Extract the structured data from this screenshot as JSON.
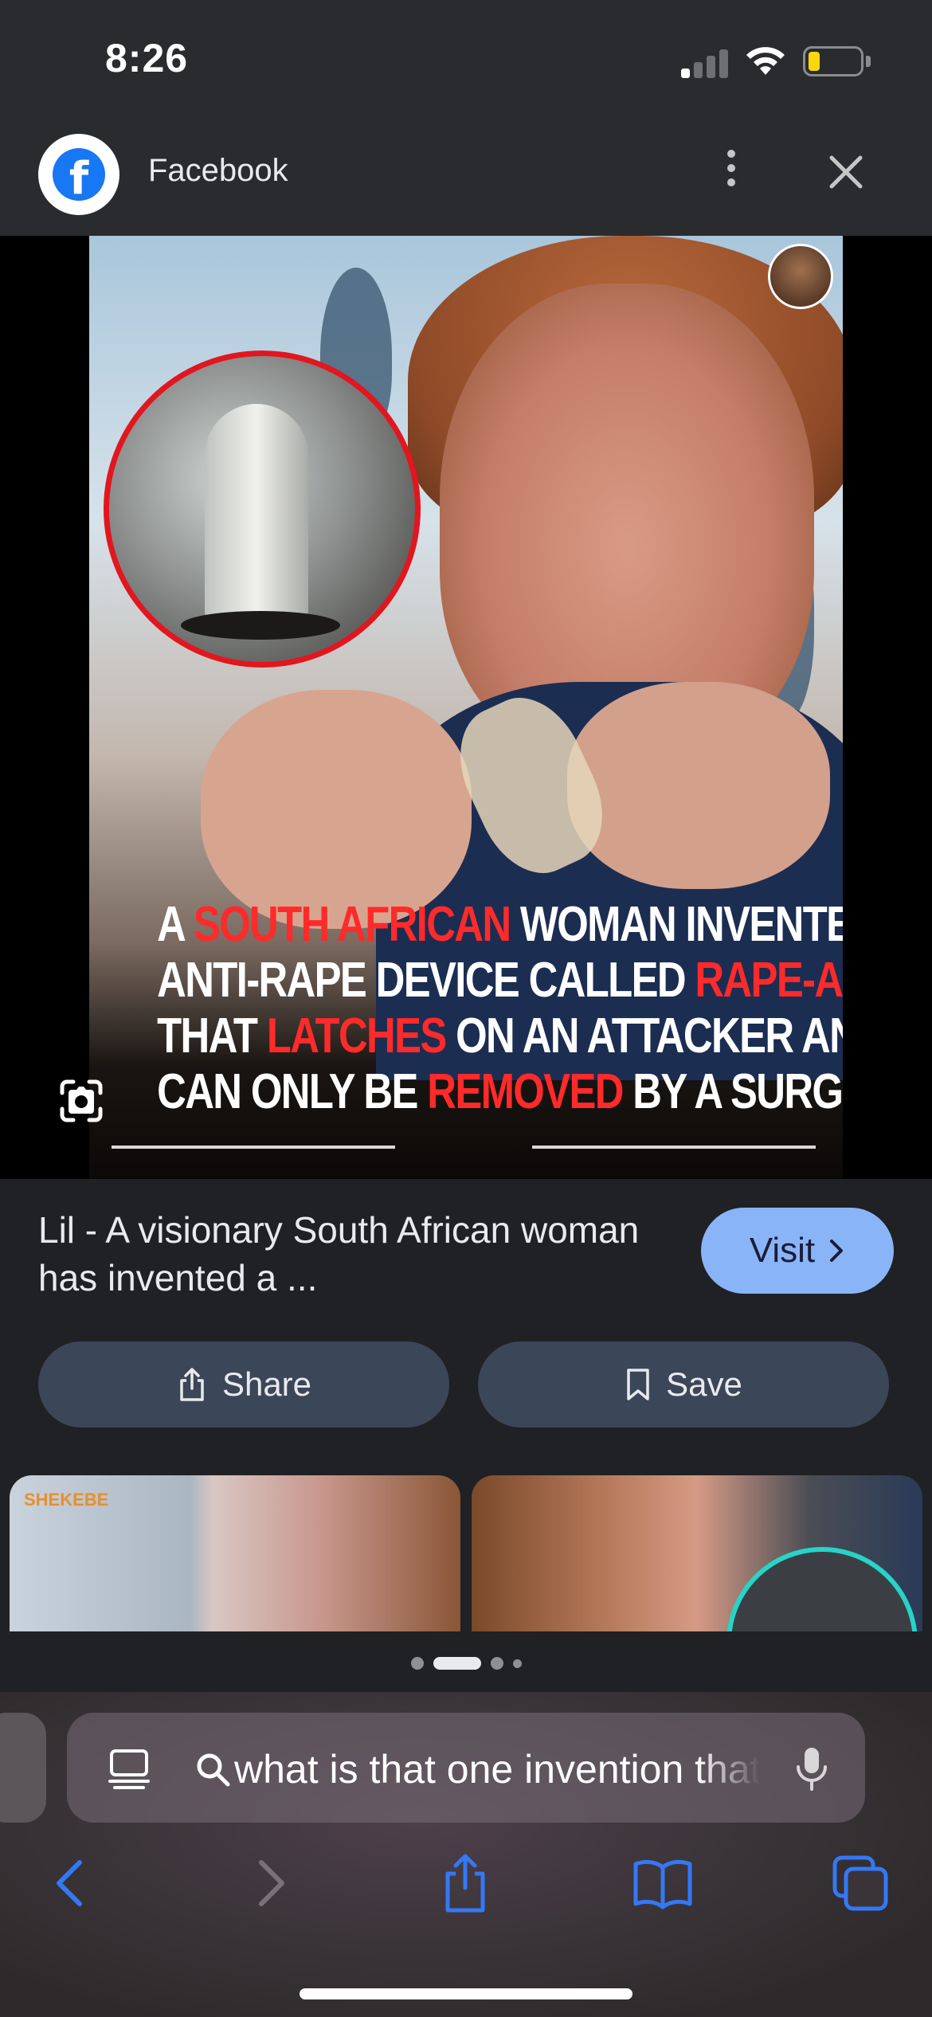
{
  "status_bar": {
    "time": "8:26"
  },
  "header": {
    "title": "Facebook",
    "favicon_letter": "f"
  },
  "image": {
    "caption_lines": [
      [
        {
          "text": "A ",
          "color": "white"
        },
        {
          "text": "SOUTH AFRICAN",
          "color": "red"
        },
        {
          "text": " WOMAN INVENTED AN",
          "color": "white"
        }
      ],
      [
        {
          "text": "ANTI-RAPE DEVICE CALLED ",
          "color": "white"
        },
        {
          "text": "RAPE-AXE",
          "color": "red"
        }
      ],
      [
        {
          "text": "THAT ",
          "color": "white"
        },
        {
          "text": "LATCHES",
          "color": "red"
        },
        {
          "text": " ON AN ATTACKER AND",
          "color": "white"
        }
      ],
      [
        {
          "text": "CAN ONLY BE ",
          "color": "white"
        },
        {
          "text": "REMOVED",
          "color": "red"
        },
        {
          "text": " BY A SURGEON",
          "color": "white"
        }
      ]
    ]
  },
  "result": {
    "title": "Lil - A visionary South African woman has invented a ...",
    "visit_label": "Visit",
    "share_label": "Share",
    "save_label": "Save"
  },
  "related": {
    "thumb1_overlay": "SHEKEBE"
  },
  "pagination": {
    "count": 4,
    "active_index": 1
  },
  "safari": {
    "address_text": "what is that one invention that",
    "icons": [
      "reader-icon",
      "search-icon",
      "mic-icon",
      "back-icon",
      "forward-icon",
      "share-icon",
      "bookmarks-icon",
      "tabs-icon"
    ]
  },
  "colors": {
    "accent": "#8ab4f8",
    "safari_blue": "#3478f6",
    "caption_red": "#ff2a2a",
    "button_bg": "#3c4659"
  }
}
